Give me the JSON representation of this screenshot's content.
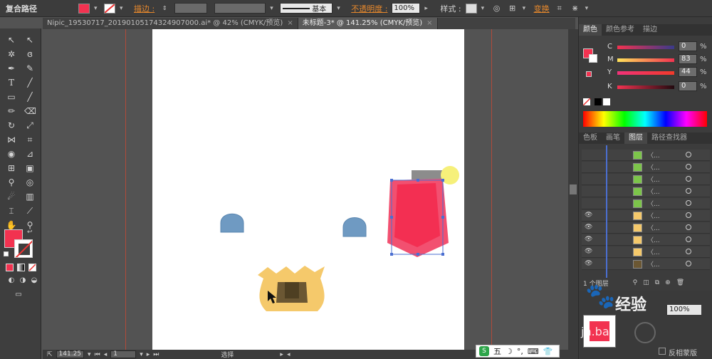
{
  "control_bar": {
    "object_type": "复合路径",
    "stroke_label": "描边 :",
    "stroke_profile": "基本",
    "opacity_label": "不透明度 :",
    "opacity_value": "100%",
    "style_label": "样式 :",
    "transform_label": "变换"
  },
  "tabs": [
    {
      "label": "Nipic_19530717_20190105174324907000.ai* @ 42% (CMYK/预览)",
      "close": "×"
    },
    {
      "label": "未标题-3* @ 141.25% (CMYK/预览)",
      "close": "×"
    }
  ],
  "color_panel": {
    "tabs": [
      "颜色",
      "颜色参考",
      "描边"
    ],
    "channels": [
      {
        "label": "C",
        "value": "0",
        "unit": "%"
      },
      {
        "label": "M",
        "value": "83",
        "unit": "%"
      },
      {
        "label": "Y",
        "value": "44",
        "unit": "%"
      },
      {
        "label": "K",
        "value": "0",
        "unit": "%"
      }
    ]
  },
  "layers_panel": {
    "tabs": [
      "色板",
      "画笔",
      "图层",
      "路径查找器"
    ],
    "row_label": "〈...",
    "layer_count": "1 个图层"
  },
  "status_bar": {
    "zoom": "141.25",
    "page": "1",
    "tool_mode": "选择"
  },
  "watermark": {
    "text": "经验",
    "url_fragment": "jn.ba"
  },
  "ime_bar": {
    "label": "五"
  },
  "appearance": {
    "opacity": "100%",
    "invert_mask": "反相蒙版"
  },
  "colors": {
    "fill": "#f23250",
    "accent_orange": "#e8892c"
  }
}
